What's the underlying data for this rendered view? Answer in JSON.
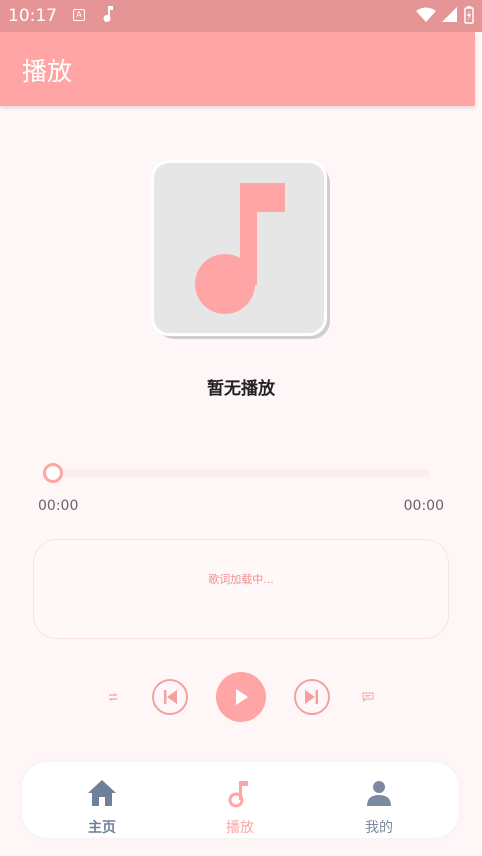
{
  "status_bar": {
    "time": "10:17",
    "badge": "A"
  },
  "app_bar": {
    "title": "播放",
    "color": "#ffa5a5"
  },
  "player": {
    "track_title": "暂无播放",
    "current_time": "00:00",
    "total_time": "00:00",
    "progress": 0,
    "lyrics_status": "歌词加载中..."
  },
  "controls": {
    "loop_icon": "repeat-icon",
    "prev_icon": "skip-previous-icon",
    "play_icon": "play-icon",
    "next_icon": "skip-next-icon",
    "lyrics_icon": "lyrics-icon"
  },
  "bottom_nav": {
    "items": [
      {
        "label": "主页",
        "icon": "home-icon"
      },
      {
        "label": "播放",
        "icon": "music-note-icon",
        "active": true
      },
      {
        "label": "我的",
        "icon": "person-icon"
      }
    ]
  }
}
